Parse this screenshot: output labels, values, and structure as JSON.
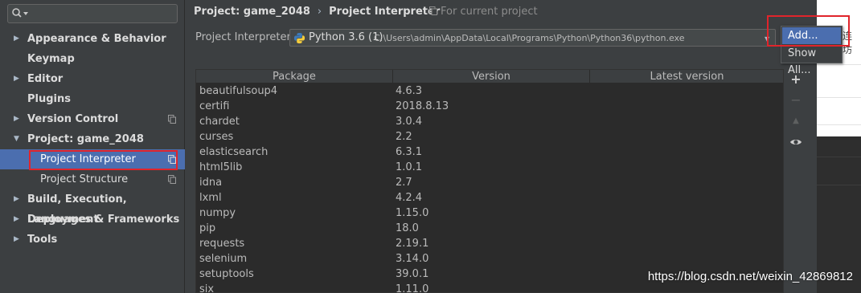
{
  "sidebar": {
    "search_placeholder": "",
    "items": [
      {
        "label": "Appearance & Behavior"
      },
      {
        "label": "Keymap"
      },
      {
        "label": "Editor"
      },
      {
        "label": "Plugins"
      },
      {
        "label": "Version Control"
      },
      {
        "label": "Project: game_2048"
      },
      {
        "label": "Project Interpreter"
      },
      {
        "label": "Project Structure"
      },
      {
        "label": "Build, Execution, Deployment"
      },
      {
        "label": "Languages & Frameworks"
      },
      {
        "label": "Tools"
      }
    ]
  },
  "breadcrumb": {
    "project": "Project: game_2048",
    "separator": "›",
    "page": "Project Interpreter",
    "note": "For current project"
  },
  "interpreter": {
    "label": "Project Interpreter:",
    "name": "Python 3.6 (1)",
    "path": "C:\\Users\\admin\\AppData\\Local\\Programs\\Python\\Python36\\python.exe"
  },
  "table": {
    "headers": [
      "Package",
      "Version",
      "Latest version"
    ],
    "rows": [
      {
        "package": "beautifulsoup4",
        "version": "4.6.3",
        "latest": ""
      },
      {
        "package": "certifi",
        "version": "2018.8.13",
        "latest": ""
      },
      {
        "package": "chardet",
        "version": "3.0.4",
        "latest": ""
      },
      {
        "package": "curses",
        "version": "2.2",
        "latest": ""
      },
      {
        "package": "elasticsearch",
        "version": "6.3.1",
        "latest": ""
      },
      {
        "package": "html5lib",
        "version": "1.0.1",
        "latest": ""
      },
      {
        "package": "idna",
        "version": "2.7",
        "latest": ""
      },
      {
        "package": "lxml",
        "version": "4.2.4",
        "latest": ""
      },
      {
        "package": "numpy",
        "version": "1.15.0",
        "latest": ""
      },
      {
        "package": "pip",
        "version": "18.0",
        "latest": ""
      },
      {
        "package": "requests",
        "version": "2.19.1",
        "latest": ""
      },
      {
        "package": "selenium",
        "version": "3.14.0",
        "latest": ""
      },
      {
        "package": "setuptools",
        "version": "39.0.1",
        "latest": ""
      },
      {
        "package": "six",
        "version": "1.11.0",
        "latest": ""
      }
    ]
  },
  "toolbar": {
    "add": "+",
    "remove": "−",
    "upgrade": "▲",
    "show": "eye-icon"
  },
  "popup": {
    "items": [
      {
        "label": "Add..."
      },
      {
        "label": "Show All..."
      }
    ]
  },
  "background_window": {
    "chars": "连坊"
  },
  "watermark": "https://blog.csdn.net/weixin_42869812",
  "colors": {
    "selection": "#4b6eaf",
    "highlight_box": "#e0242b",
    "panel": "#3c3f41",
    "table_bg": "#2b2b2b"
  }
}
